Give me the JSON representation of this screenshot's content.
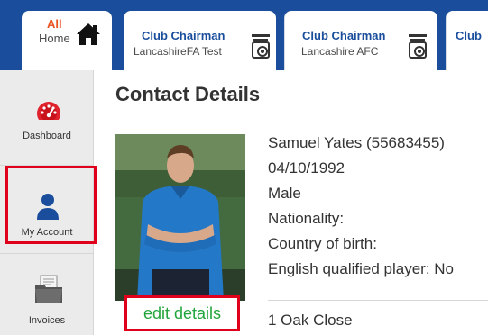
{
  "tabs": {
    "home": {
      "top_label": "All",
      "label": "Home",
      "icon": "home-icon"
    },
    "items": [
      {
        "title": "Club Chairman",
        "subtitle": "LancashireFA Test",
        "icon": "certificate-icon"
      },
      {
        "title": "Club Chairman",
        "subtitle": "Lancashire AFC",
        "icon": "certificate-icon"
      },
      {
        "title": "Club"
      }
    ]
  },
  "sidebar": {
    "items": [
      {
        "label": "Dashboard",
        "icon": "dashboard-gauge-icon"
      },
      {
        "label": "My Account",
        "icon": "user-icon"
      },
      {
        "label": "Invoices",
        "icon": "invoice-folder-icon"
      }
    ]
  },
  "main": {
    "title": "Contact Details",
    "edit_link": "edit details",
    "details": {
      "name": "Samuel Yates (55683455)",
      "dob": "04/10/1992",
      "gender": "Male",
      "nationality": "Nationality:",
      "country_of_birth": "Country of birth:",
      "english_qualified": "English qualified player: No"
    },
    "address_line1": "1 Oak Close"
  },
  "colors": {
    "brand_blue": "#1a4e9c",
    "accent_orange": "#e8531f",
    "highlight_red": "#e0001b",
    "link_green": "#22a53c"
  }
}
